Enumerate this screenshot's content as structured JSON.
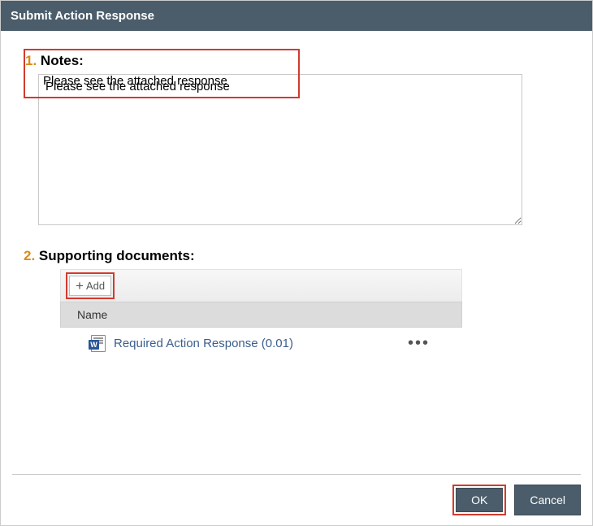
{
  "header": {
    "title": "Submit Action Response"
  },
  "notes": {
    "number": "1.",
    "label": "Notes:",
    "value": "Please see the attached response"
  },
  "documents": {
    "number": "2.",
    "label": "Supporting documents:",
    "addLabel": "Add",
    "columnHeader": "Name",
    "rows": [
      {
        "name": "Required Action Response (0.01)"
      }
    ]
  },
  "footer": {
    "ok": "OK",
    "cancel": "Cancel"
  }
}
